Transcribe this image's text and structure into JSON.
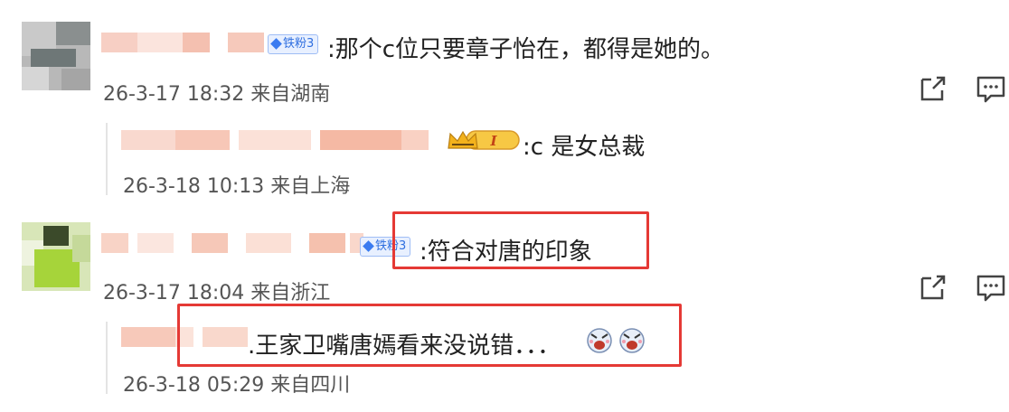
{
  "comments": [
    {
      "text": ":那个c位只要章子怡在，都得是她的。",
      "badge": "铁粉3",
      "meta": "26-3-17 18:32 来自湖南",
      "reply": {
        "text": ":c 是女总裁",
        "badge": "I",
        "meta": "26-3-18 10:13 来自上海"
      }
    },
    {
      "text": ":符合对唐的印象",
      "badge": "铁粉3",
      "meta": "26-3-17 18:04 来自浙江",
      "reply": {
        "text": ".王家卫嘴唐嫣看来没说错．．．",
        "meta": "26-3-18 05:29 来自四川"
      }
    }
  ],
  "icons": {
    "share": "share-icon",
    "comment": "comment-icon",
    "emoji": "laughing-emoji-icon"
  },
  "colors": {
    "highlight": "#e53935",
    "badge_blue": "#3a7bf0",
    "crown_gold": "#f3b21c"
  }
}
